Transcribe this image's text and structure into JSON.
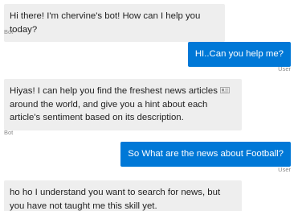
{
  "messages": [
    {
      "role": "bot",
      "text": "Hi there! I'm chervine's bot! How can I help you today?",
      "sender": "Bot"
    },
    {
      "role": "user",
      "text": "HI..Can you help me?",
      "sender": "User"
    },
    {
      "role": "bot",
      "text_part1": "Hiyas! I can help you find the freshest news articles",
      "inline_icon": "newspaper-icon",
      "text_part2": "around the world, and give you a hint about each article's sentiment based on its description.",
      "sender": "Bot"
    },
    {
      "role": "user",
      "text": "So What are the news about Football?",
      "sender": "User"
    },
    {
      "role": "bot",
      "text": "ho ho I understand you want to search for news, but you have not taught me this skill yet."
    }
  ],
  "colors": {
    "bot_bubble": "#eeeeee",
    "user_bubble": "#0078d7",
    "sender_label": "#8a8a8a"
  }
}
